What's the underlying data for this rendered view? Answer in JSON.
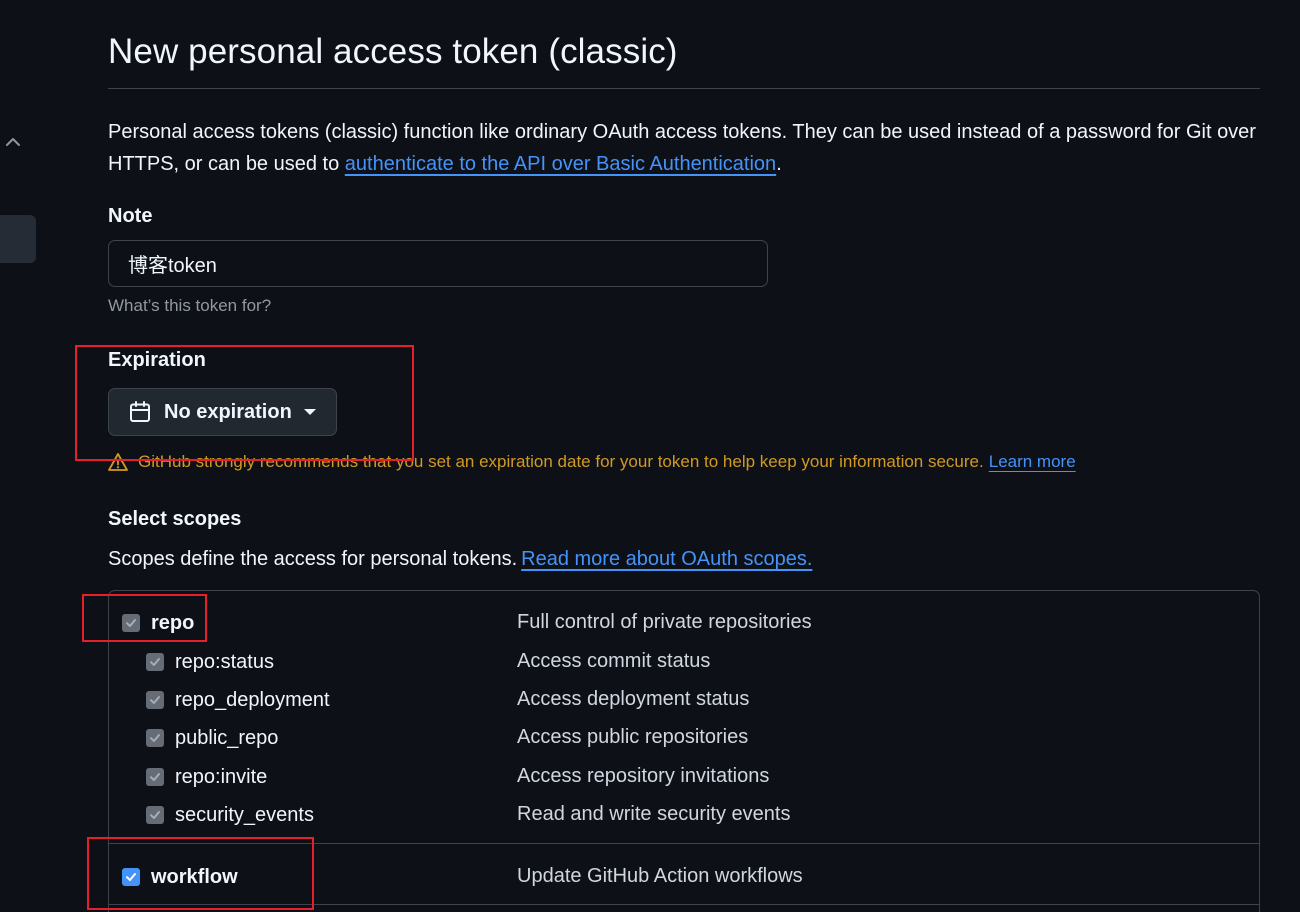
{
  "page": {
    "title": "New personal access token (classic)",
    "intro_text": "Personal access tokens (classic) function like ordinary OAuth access tokens. They can be used instead of a password for Git over HTTPS, or can be used to ",
    "intro_link": "authenticate to the API over Basic Authentication",
    "intro_end": "."
  },
  "note": {
    "label": "Note",
    "value": "博客token",
    "hint": "What’s this token for?"
  },
  "expiration": {
    "label": "Expiration",
    "selected": "No expiration",
    "warning_text": "GitHub strongly recommends that you set an expiration date for your token to help keep your information secure.",
    "warning_link": "Learn more"
  },
  "scopes": {
    "label": "Select scopes",
    "description": "Scopes define the access for personal tokens.",
    "description_link": "Read more about OAuth scopes.",
    "items": [
      {
        "name": "repo",
        "description": "Full control of private repositories",
        "checked": true,
        "parent": true
      },
      {
        "name": "repo:status",
        "description": "Access commit status",
        "checked": true,
        "parent": false
      },
      {
        "name": "repo_deployment",
        "description": "Access deployment status",
        "checked": true,
        "parent": false
      },
      {
        "name": "public_repo",
        "description": "Access public repositories",
        "checked": true,
        "parent": false
      },
      {
        "name": "repo:invite",
        "description": "Access repository invitations",
        "checked": true,
        "parent": false
      },
      {
        "name": "security_events",
        "description": "Read and write security events",
        "checked": true,
        "parent": false
      },
      {
        "name": "workflow",
        "description": "Update GitHub Action workflows",
        "checked": true,
        "parent": true
      }
    ]
  },
  "colors": {
    "background": "#0d1117",
    "link": "#4493f8",
    "warning": "#d29922",
    "annotation": "#e5202a"
  },
  "icons": [
    "chevron-up-icon",
    "calendar-icon",
    "triangle-down-icon",
    "alert-icon",
    "check-icon"
  ]
}
